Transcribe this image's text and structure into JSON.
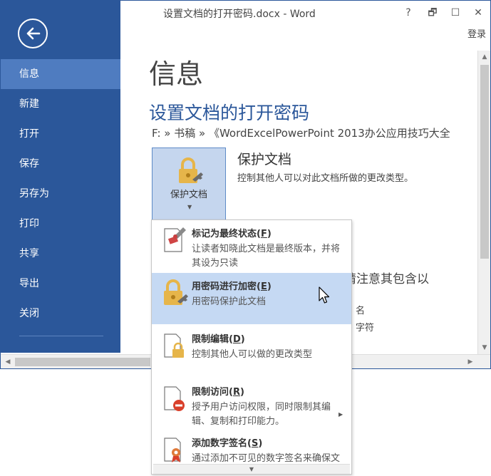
{
  "window": {
    "title": "设置文档的打开密码.docx - Word",
    "help": "?",
    "restore": "🗗",
    "maximize": "☐",
    "close": "✕",
    "login": "登录"
  },
  "sidebar": {
    "back_icon": "back-arrow-icon",
    "items": [
      {
        "label": "信息"
      },
      {
        "label": "新建"
      },
      {
        "label": "打开"
      },
      {
        "label": "保存"
      },
      {
        "label": "另存为"
      },
      {
        "label": "打印"
      },
      {
        "label": "共享"
      },
      {
        "label": "导出"
      },
      {
        "label": "关闭"
      }
    ],
    "active_index": 0
  },
  "main": {
    "page_title": "信息",
    "doc_title": "设置文档的打开密码",
    "doc_path": "F: » 书稿 » 《WordExcelPowerPoint 2013办公应用技巧大全",
    "protect": {
      "button_label": "保护文档",
      "dropdown_arrow": "▼",
      "heading": "保护文档",
      "description": "控制其他人可以对此文档所做的更改类型。"
    },
    "background_fragments": {
      "inspect_text": "请注意其包含以",
      "line_name": "名",
      "line_chars": "字符"
    }
  },
  "menu": {
    "items": [
      {
        "title": "标记为最终状态",
        "key": "F",
        "description": "让读者知晓此文档是最终版本，并将其设为只读",
        "icon": "mark-final-icon"
      },
      {
        "title": "用密码进行加密",
        "key": "E",
        "description": "用密码保护此文档",
        "icon": "lock-key-icon"
      },
      {
        "title": "限制编辑",
        "key": "D",
        "description": "控制其他人可以做的更改类型",
        "icon": "restrict-editing-icon"
      },
      {
        "title": "限制访问",
        "key": "R",
        "description": "授予用户访问权限，同时限制其编辑、复制和打印能力。",
        "icon": "restrict-access-icon"
      },
      {
        "title": "添加数字签名",
        "key": "S",
        "description": "通过添加不可见的数字签名来确保文档的完整性",
        "icon": "digital-signature-icon"
      }
    ],
    "submenu_arrow": "▶",
    "scroll_down": "▼",
    "highlighted_index": 1
  },
  "scrollbars": {
    "up": "▲",
    "down": "▼",
    "left": "◀",
    "right": "▶"
  },
  "colors": {
    "accent": "#2b579a",
    "sidebar_active": "#4f7cc0",
    "highlight": "#c5d9f3",
    "lock_gold": "#e6b54a"
  }
}
